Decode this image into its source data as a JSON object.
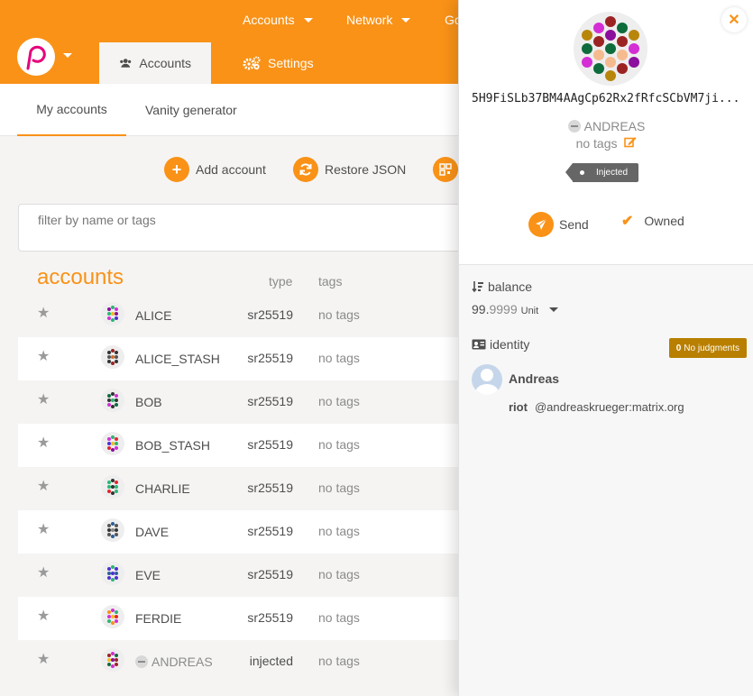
{
  "colors": {
    "accent": "#f99217",
    "judgment_badge": "#b87f00",
    "tag_bg": "#666666"
  },
  "topbar": {
    "menus": [
      {
        "label": "Accounts",
        "icon": "caret-down-icon"
      },
      {
        "label": "Network",
        "icon": "caret-down-icon"
      },
      {
        "label": "Go"
      }
    ],
    "tabs": [
      {
        "label": "Accounts",
        "icon": "users-icon",
        "active": true
      },
      {
        "label": "Settings",
        "icon": "gears-icon",
        "active": false
      }
    ]
  },
  "subnav": {
    "tabs": [
      {
        "label": "My accounts",
        "active": true
      },
      {
        "label": "Vanity generator",
        "active": false
      }
    ]
  },
  "actions": {
    "add_account": {
      "label": "Add account",
      "icon": "plus-icon"
    },
    "restore_json": {
      "label": "Restore JSON",
      "icon": "sync-icon"
    },
    "qr": {
      "icon": "qrcode-icon"
    }
  },
  "filter": {
    "placeholder": "filter by name or tags"
  },
  "table": {
    "title": "accounts",
    "col_type": "type",
    "col_tags": "tags",
    "rows": [
      {
        "name": "ALICE",
        "type": "sr25519",
        "tags": "no tags"
      },
      {
        "name": "ALICE_STASH",
        "type": "sr25519",
        "tags": "no tags"
      },
      {
        "name": "BOB",
        "type": "sr25519",
        "tags": "no tags"
      },
      {
        "name": "BOB_STASH",
        "type": "sr25519",
        "tags": "no tags"
      },
      {
        "name": "CHARLIE",
        "type": "sr25519",
        "tags": "no tags"
      },
      {
        "name": "DAVE",
        "type": "sr25519",
        "tags": "no tags"
      },
      {
        "name": "EVE",
        "type": "sr25519",
        "tags": "no tags"
      },
      {
        "name": "FERDIE",
        "type": "sr25519",
        "tags": "no tags"
      },
      {
        "name": "ANDREAS",
        "type": "injected",
        "tags": "no tags"
      }
    ]
  },
  "sidebar": {
    "address": "5H9FiSLb37BM4AAgCp62Rx2fRfcSCbVM7ji...",
    "name": "ANDREAS",
    "tags": "no tags",
    "injected_label": "Injected",
    "send_label": "Send",
    "owned_label": "Owned",
    "balance_label": "balance",
    "balance_int": "99.",
    "balance_dec": "9999",
    "balance_unit": "Unit",
    "identity_label": "identity",
    "judgments_count": "0",
    "judgments_label": "No judgments",
    "identity_name": "Andreas",
    "riot_label": "riot",
    "riot_value": "@andreaskrueger:matrix.org"
  }
}
